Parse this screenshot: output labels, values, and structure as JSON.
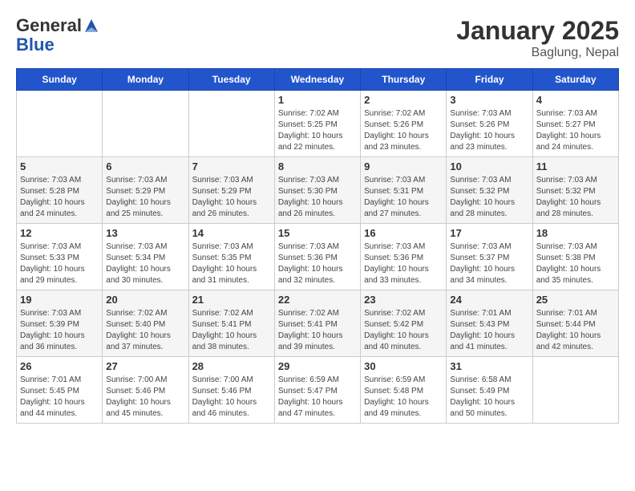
{
  "header": {
    "logo_line1": "General",
    "logo_line2": "Blue",
    "title": "January 2025",
    "subtitle": "Baglung, Nepal"
  },
  "days_of_week": [
    "Sunday",
    "Monday",
    "Tuesday",
    "Wednesday",
    "Thursday",
    "Friday",
    "Saturday"
  ],
  "weeks": [
    [
      {
        "day": "",
        "info": ""
      },
      {
        "day": "",
        "info": ""
      },
      {
        "day": "",
        "info": ""
      },
      {
        "day": "1",
        "info": "Sunrise: 7:02 AM\nSunset: 5:25 PM\nDaylight: 10 hours\nand 22 minutes."
      },
      {
        "day": "2",
        "info": "Sunrise: 7:02 AM\nSunset: 5:26 PM\nDaylight: 10 hours\nand 23 minutes."
      },
      {
        "day": "3",
        "info": "Sunrise: 7:03 AM\nSunset: 5:26 PM\nDaylight: 10 hours\nand 23 minutes."
      },
      {
        "day": "4",
        "info": "Sunrise: 7:03 AM\nSunset: 5:27 PM\nDaylight: 10 hours\nand 24 minutes."
      }
    ],
    [
      {
        "day": "5",
        "info": "Sunrise: 7:03 AM\nSunset: 5:28 PM\nDaylight: 10 hours\nand 24 minutes."
      },
      {
        "day": "6",
        "info": "Sunrise: 7:03 AM\nSunset: 5:29 PM\nDaylight: 10 hours\nand 25 minutes."
      },
      {
        "day": "7",
        "info": "Sunrise: 7:03 AM\nSunset: 5:29 PM\nDaylight: 10 hours\nand 26 minutes."
      },
      {
        "day": "8",
        "info": "Sunrise: 7:03 AM\nSunset: 5:30 PM\nDaylight: 10 hours\nand 26 minutes."
      },
      {
        "day": "9",
        "info": "Sunrise: 7:03 AM\nSunset: 5:31 PM\nDaylight: 10 hours\nand 27 minutes."
      },
      {
        "day": "10",
        "info": "Sunrise: 7:03 AM\nSunset: 5:32 PM\nDaylight: 10 hours\nand 28 minutes."
      },
      {
        "day": "11",
        "info": "Sunrise: 7:03 AM\nSunset: 5:32 PM\nDaylight: 10 hours\nand 28 minutes."
      }
    ],
    [
      {
        "day": "12",
        "info": "Sunrise: 7:03 AM\nSunset: 5:33 PM\nDaylight: 10 hours\nand 29 minutes."
      },
      {
        "day": "13",
        "info": "Sunrise: 7:03 AM\nSunset: 5:34 PM\nDaylight: 10 hours\nand 30 minutes."
      },
      {
        "day": "14",
        "info": "Sunrise: 7:03 AM\nSunset: 5:35 PM\nDaylight: 10 hours\nand 31 minutes."
      },
      {
        "day": "15",
        "info": "Sunrise: 7:03 AM\nSunset: 5:36 PM\nDaylight: 10 hours\nand 32 minutes."
      },
      {
        "day": "16",
        "info": "Sunrise: 7:03 AM\nSunset: 5:36 PM\nDaylight: 10 hours\nand 33 minutes."
      },
      {
        "day": "17",
        "info": "Sunrise: 7:03 AM\nSunset: 5:37 PM\nDaylight: 10 hours\nand 34 minutes."
      },
      {
        "day": "18",
        "info": "Sunrise: 7:03 AM\nSunset: 5:38 PM\nDaylight: 10 hours\nand 35 minutes."
      }
    ],
    [
      {
        "day": "19",
        "info": "Sunrise: 7:03 AM\nSunset: 5:39 PM\nDaylight: 10 hours\nand 36 minutes."
      },
      {
        "day": "20",
        "info": "Sunrise: 7:02 AM\nSunset: 5:40 PM\nDaylight: 10 hours\nand 37 minutes."
      },
      {
        "day": "21",
        "info": "Sunrise: 7:02 AM\nSunset: 5:41 PM\nDaylight: 10 hours\nand 38 minutes."
      },
      {
        "day": "22",
        "info": "Sunrise: 7:02 AM\nSunset: 5:41 PM\nDaylight: 10 hours\nand 39 minutes."
      },
      {
        "day": "23",
        "info": "Sunrise: 7:02 AM\nSunset: 5:42 PM\nDaylight: 10 hours\nand 40 minutes."
      },
      {
        "day": "24",
        "info": "Sunrise: 7:01 AM\nSunset: 5:43 PM\nDaylight: 10 hours\nand 41 minutes."
      },
      {
        "day": "25",
        "info": "Sunrise: 7:01 AM\nSunset: 5:44 PM\nDaylight: 10 hours\nand 42 minutes."
      }
    ],
    [
      {
        "day": "26",
        "info": "Sunrise: 7:01 AM\nSunset: 5:45 PM\nDaylight: 10 hours\nand 44 minutes."
      },
      {
        "day": "27",
        "info": "Sunrise: 7:00 AM\nSunset: 5:46 PM\nDaylight: 10 hours\nand 45 minutes."
      },
      {
        "day": "28",
        "info": "Sunrise: 7:00 AM\nSunset: 5:46 PM\nDaylight: 10 hours\nand 46 minutes."
      },
      {
        "day": "29",
        "info": "Sunrise: 6:59 AM\nSunset: 5:47 PM\nDaylight: 10 hours\nand 47 minutes."
      },
      {
        "day": "30",
        "info": "Sunrise: 6:59 AM\nSunset: 5:48 PM\nDaylight: 10 hours\nand 49 minutes."
      },
      {
        "day": "31",
        "info": "Sunrise: 6:58 AM\nSunset: 5:49 PM\nDaylight: 10 hours\nand 50 minutes."
      },
      {
        "day": "",
        "info": ""
      }
    ]
  ]
}
